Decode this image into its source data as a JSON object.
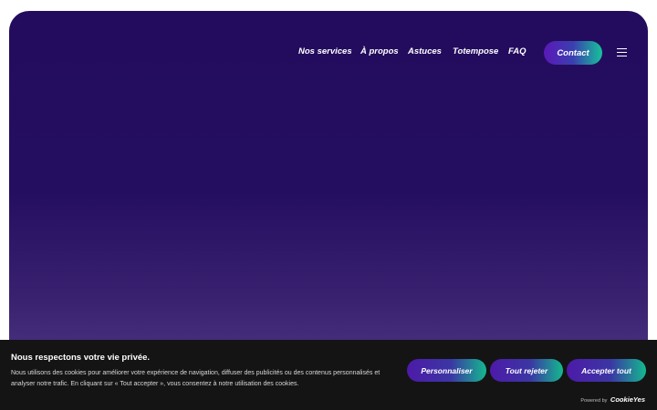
{
  "nav": {
    "links": [
      "Nos services",
      "À propos",
      "Astuces",
      "Totempose",
      "FAQ"
    ],
    "contact_label": "Contact",
    "menu_icon": "hamburger-menu-icon"
  },
  "cookie_banner": {
    "title": "Nous respectons votre vie privée.",
    "text": "Nous utilisons des cookies pour améliorer votre expérience de navigation, diffuser des publicités ou des contenus personnalisés et analyser notre trafic. En cliquant sur « Tout accepter », vous consentez à notre utilisation des cookies.",
    "buttons": {
      "customize": "Personnaliser",
      "reject": "Tout rejeter",
      "accept": "Accepter tout"
    },
    "powered_by": "Powered by",
    "brand": "CookieYes"
  },
  "colors": {
    "hero_top": "#230c5e",
    "hero_bottom": "#54408a",
    "banner_bg": "#141414",
    "button_start": "#5b18b8",
    "button_end": "#16c39a"
  }
}
